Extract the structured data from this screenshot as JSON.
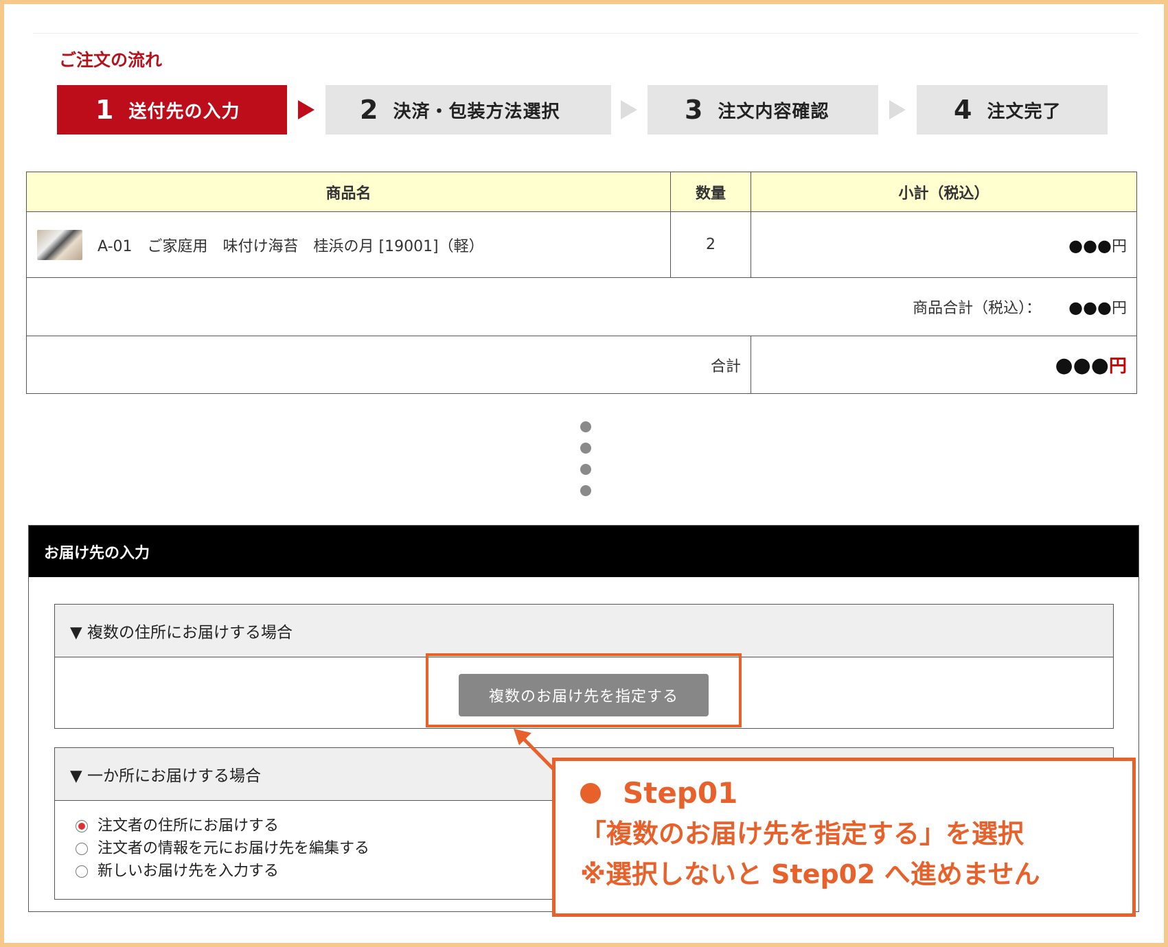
{
  "flow": {
    "title": "ご注文の流れ",
    "steps": [
      {
        "num": "1",
        "label": "送付先の入力",
        "active": true
      },
      {
        "num": "2",
        "label": "決済・包装方法選択",
        "active": false
      },
      {
        "num": "3",
        "label": "注文内容確認",
        "active": false
      },
      {
        "num": "4",
        "label": "注文完了",
        "active": false
      }
    ]
  },
  "cart": {
    "headers": {
      "name": "商品名",
      "qty": "数量",
      "subtotal": "小計（税込）"
    },
    "item": {
      "name": "A-01　ご家庭用　味付け海苔　桂浜の月 [19001]（軽）",
      "qty": "2",
      "price": "●●●",
      "yen": "円"
    },
    "goods_total_label": "商品合計（税込）：",
    "goods_total_value": "●●●",
    "goods_total_yen": "円",
    "total_label": "合計",
    "total_value": "●●●",
    "total_yen": "円"
  },
  "delivery": {
    "title": "お届け先の入力",
    "multi": {
      "heading": "▼ 複数の住所にお届けする場合",
      "button": "複数のお届け先を指定する"
    },
    "single": {
      "heading": "▼ 一か所にお届けする場合",
      "options": [
        "注文者の住所にお届けする",
        "注文者の情報を元にお届け先を編集する",
        "新しいお届け先を入力する"
      ],
      "selected_index": 0
    }
  },
  "callout": {
    "line1": "Step01",
    "line2": "「複数のお届け先を指定する」を選択",
    "line3": "※選択しないと Step02 へ進めません"
  },
  "colors": {
    "accent_red": "#bd0d1a",
    "callout_orange": "#e8602a",
    "frame": "#f6c98a"
  }
}
